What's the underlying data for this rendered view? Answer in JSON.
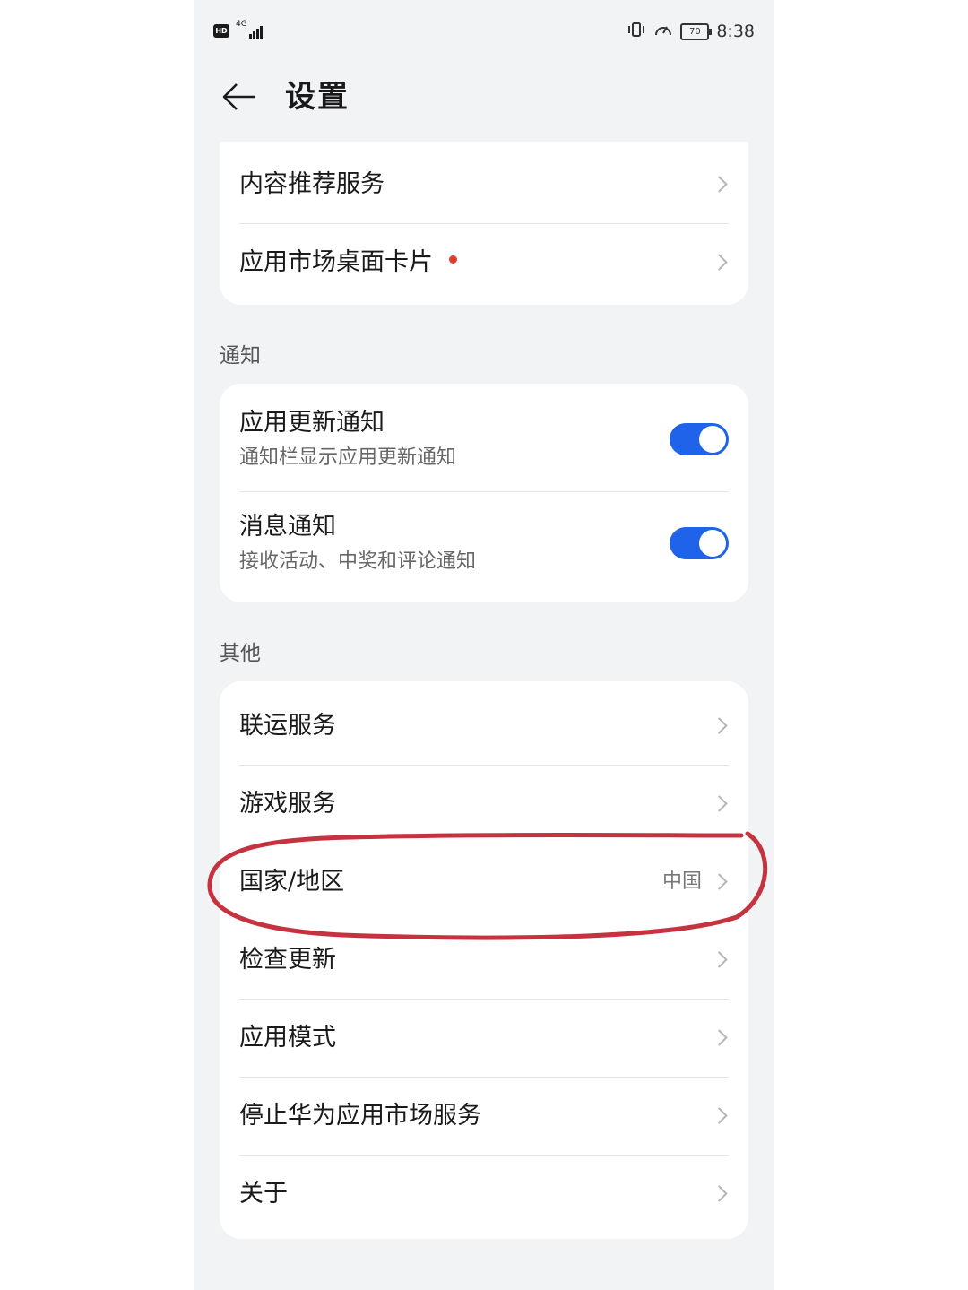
{
  "status_bar": {
    "hd": "HD",
    "network": "4G",
    "battery": "70",
    "time": "8:38"
  },
  "header": {
    "title": "设置"
  },
  "top_group": {
    "items": [
      {
        "label": "内容推荐服务"
      },
      {
        "label": "应用市场桌面卡片",
        "badge": "red-dot"
      }
    ]
  },
  "notifications": {
    "section_title": "通知",
    "items": [
      {
        "label": "应用更新通知",
        "subtitle": "通知栏显示应用更新通知",
        "toggle": true
      },
      {
        "label": "消息通知",
        "subtitle": "接收活动、中奖和评论通知",
        "toggle": true
      }
    ]
  },
  "other": {
    "section_title": "其他",
    "items": [
      {
        "label": "联运服务"
      },
      {
        "label": "游戏服务"
      },
      {
        "label": "国家/地区",
        "value": "中国"
      },
      {
        "label": "检查更新"
      },
      {
        "label": "应用模式"
      },
      {
        "label": "停止华为应用市场服务"
      },
      {
        "label": "关于"
      }
    ]
  },
  "colors": {
    "toggle_on": "#1e63e9",
    "badge": "#e53a2e",
    "annotation": "#c4333f",
    "background": "#f1f3f5"
  },
  "icons": [
    "back-arrow-icon",
    "chevron-right-icon",
    "vibrate-icon",
    "speed-icon",
    "battery-icon",
    "signal-icon"
  ]
}
